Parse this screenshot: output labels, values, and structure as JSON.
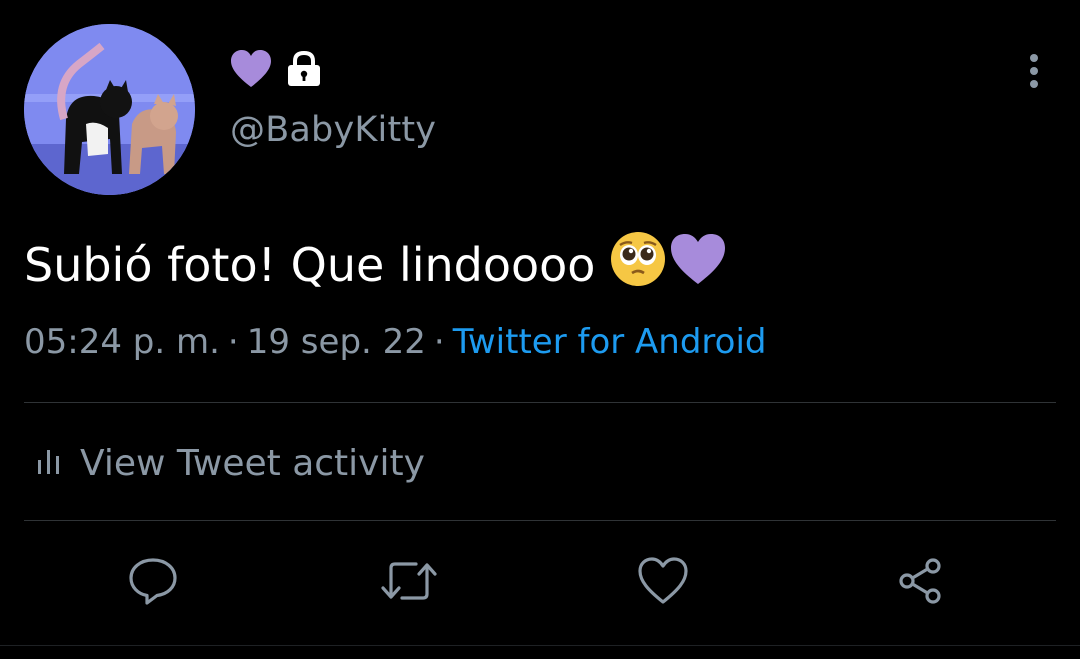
{
  "tweet": {
    "handle": "@BabyKitty",
    "text": "Subió foto! Que lindoooo",
    "emojis": [
      "pleading-face-icon",
      "purple-heart-icon"
    ],
    "time": "05:24 p. m.",
    "separator": "·",
    "date": "19 sep. 22",
    "source": "Twitter for Android",
    "activity_label": "View Tweet activity"
  },
  "colors": {
    "background": "#000000",
    "text": "#ffffff",
    "muted": "#8b98a5",
    "link": "#1d9bf0",
    "purple_heart": "#a78bdb",
    "divider": "#2f3336"
  },
  "icons": {
    "name_icons": [
      "purple-heart-icon",
      "lock-icon"
    ],
    "more": "more-vertical-icon",
    "activity": "bar-chart-icon",
    "actions": [
      "reply-icon",
      "retweet-icon",
      "like-icon",
      "share-icon"
    ]
  }
}
